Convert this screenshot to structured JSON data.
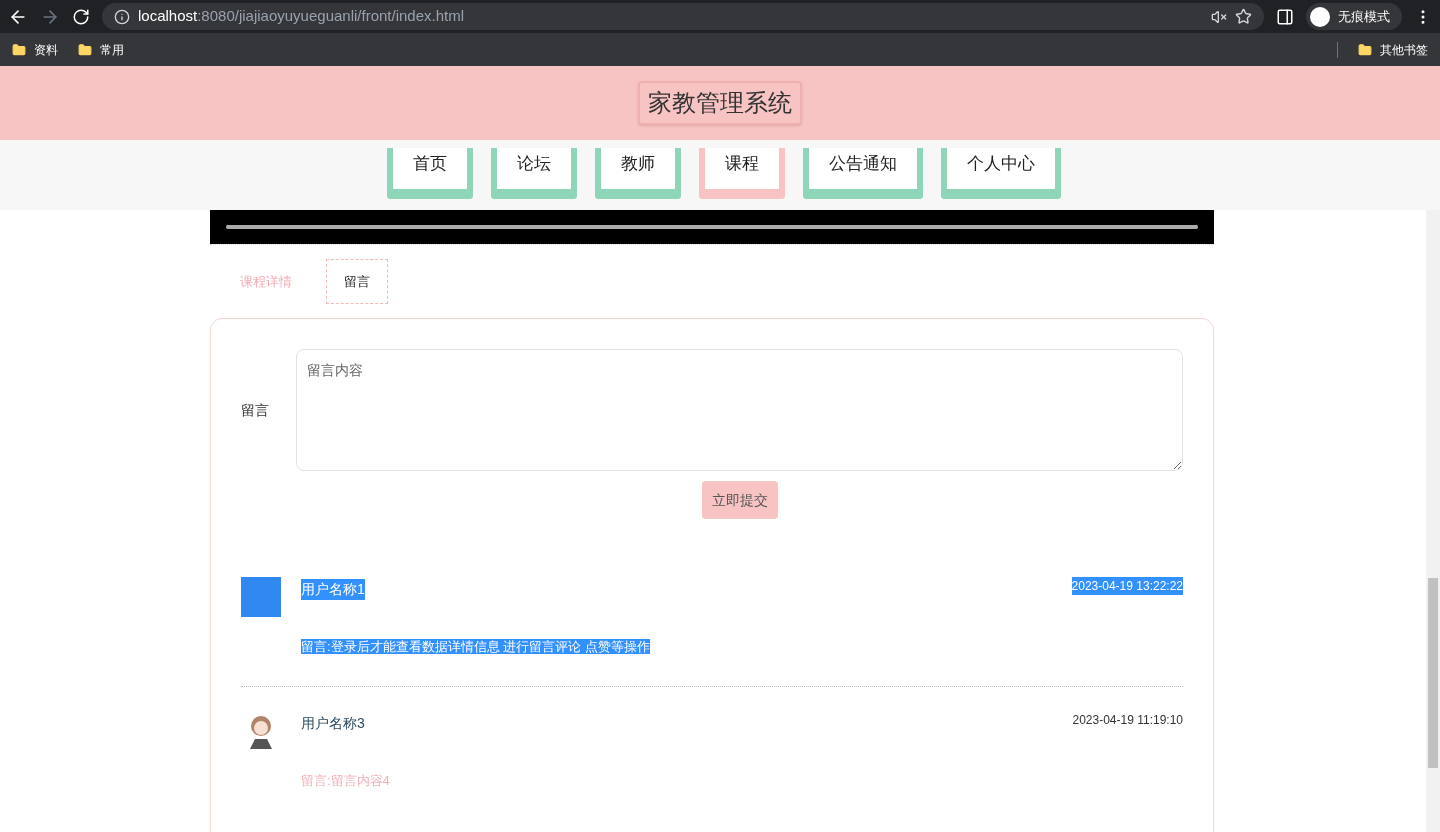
{
  "browser": {
    "url_host": "localhost",
    "url_path": ":8080/jiajiaoyuyueguanli/front/index.html",
    "profile": "无痕模式",
    "bookmarks": [
      "资料",
      "常用"
    ],
    "other_bookmarks": "其他书签"
  },
  "header": {
    "title": "家教管理系统"
  },
  "video": {
    "level": 1
  },
  "nav": [
    {
      "label": "首页",
      "selected": false
    },
    {
      "label": "论坛",
      "selected": false
    },
    {
      "label": "教师",
      "selected": false
    },
    {
      "label": "课程",
      "selected": true
    },
    {
      "label": "公告通知",
      "selected": false
    },
    {
      "label": "个人中心",
      "selected": false
    }
  ],
  "detail_tabs": [
    {
      "label": "课程详情",
      "selected": false
    },
    {
      "label": "留言",
      "selected": true
    }
  ],
  "form": {
    "label": "留言",
    "placeholder": "留言内容",
    "submit": "立即提交"
  },
  "comments": [
    {
      "user": "用户名称1",
      "time": "2023-04-19 13:22:22",
      "content": "留言:登录后才能查看数据详情信息 进行留言评论 点赞等操作",
      "highlighted": true,
      "kind": "photo"
    },
    {
      "user": "用户名称3",
      "time": "2023-04-19 11:19:10",
      "content": "留言:留言内容4",
      "highlighted": false,
      "kind": "illustration"
    }
  ]
}
